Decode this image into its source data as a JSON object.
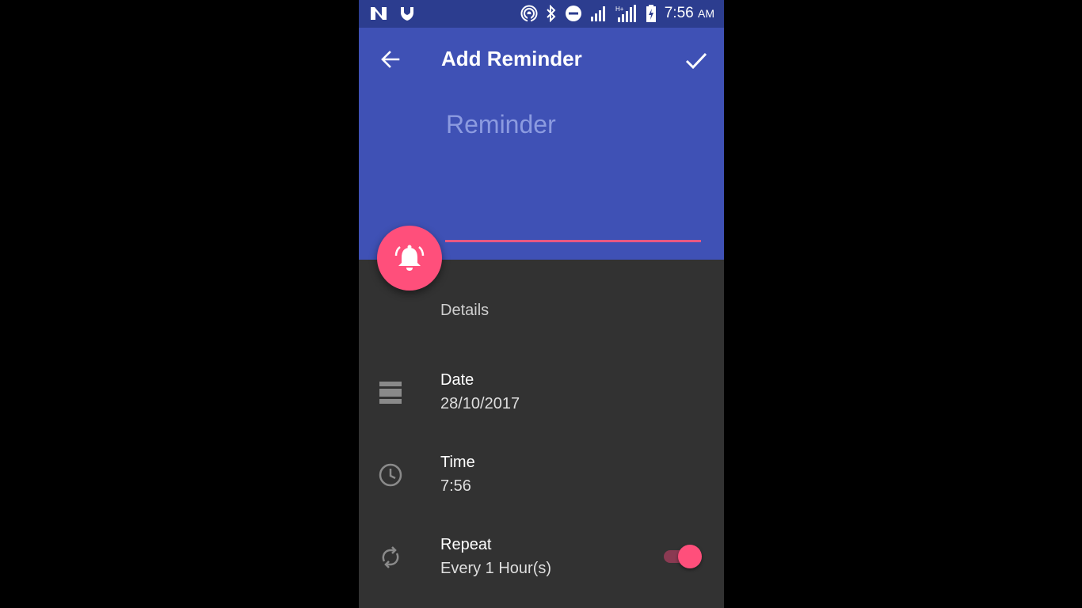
{
  "status_bar": {
    "time": "7:56",
    "ampm": "AM",
    "icons": [
      "n-logo-icon",
      "shield-icon",
      "hotspot-icon",
      "bluetooth-icon",
      "do-not-disturb-icon",
      "signal-icon",
      "signal-h-plus-icon",
      "battery-charging-icon"
    ]
  },
  "app_bar": {
    "title": "Add Reminder",
    "back_icon": "arrow-back-icon",
    "save_icon": "check-icon",
    "background": "#3f51b5"
  },
  "reminder_input": {
    "placeholder": "Reminder",
    "value": ""
  },
  "fab": {
    "icon": "alarm-bell-icon",
    "color": "#ff4f7b"
  },
  "details": {
    "section_label": "Details",
    "date": {
      "label": "Date",
      "value": "28/10/2017",
      "icon": "calendar-icon"
    },
    "time": {
      "label": "Time",
      "value": "7:56",
      "icon": "clock-icon"
    },
    "repeat": {
      "label": "Repeat",
      "value": "Every 1 Hour(s)",
      "icon": "repeat-icon",
      "enabled": true
    }
  },
  "colors": {
    "accent": "#ff4f7b",
    "primary": "#3f51b5",
    "status_bar": "#2c3d8f",
    "surface": "#323232"
  }
}
